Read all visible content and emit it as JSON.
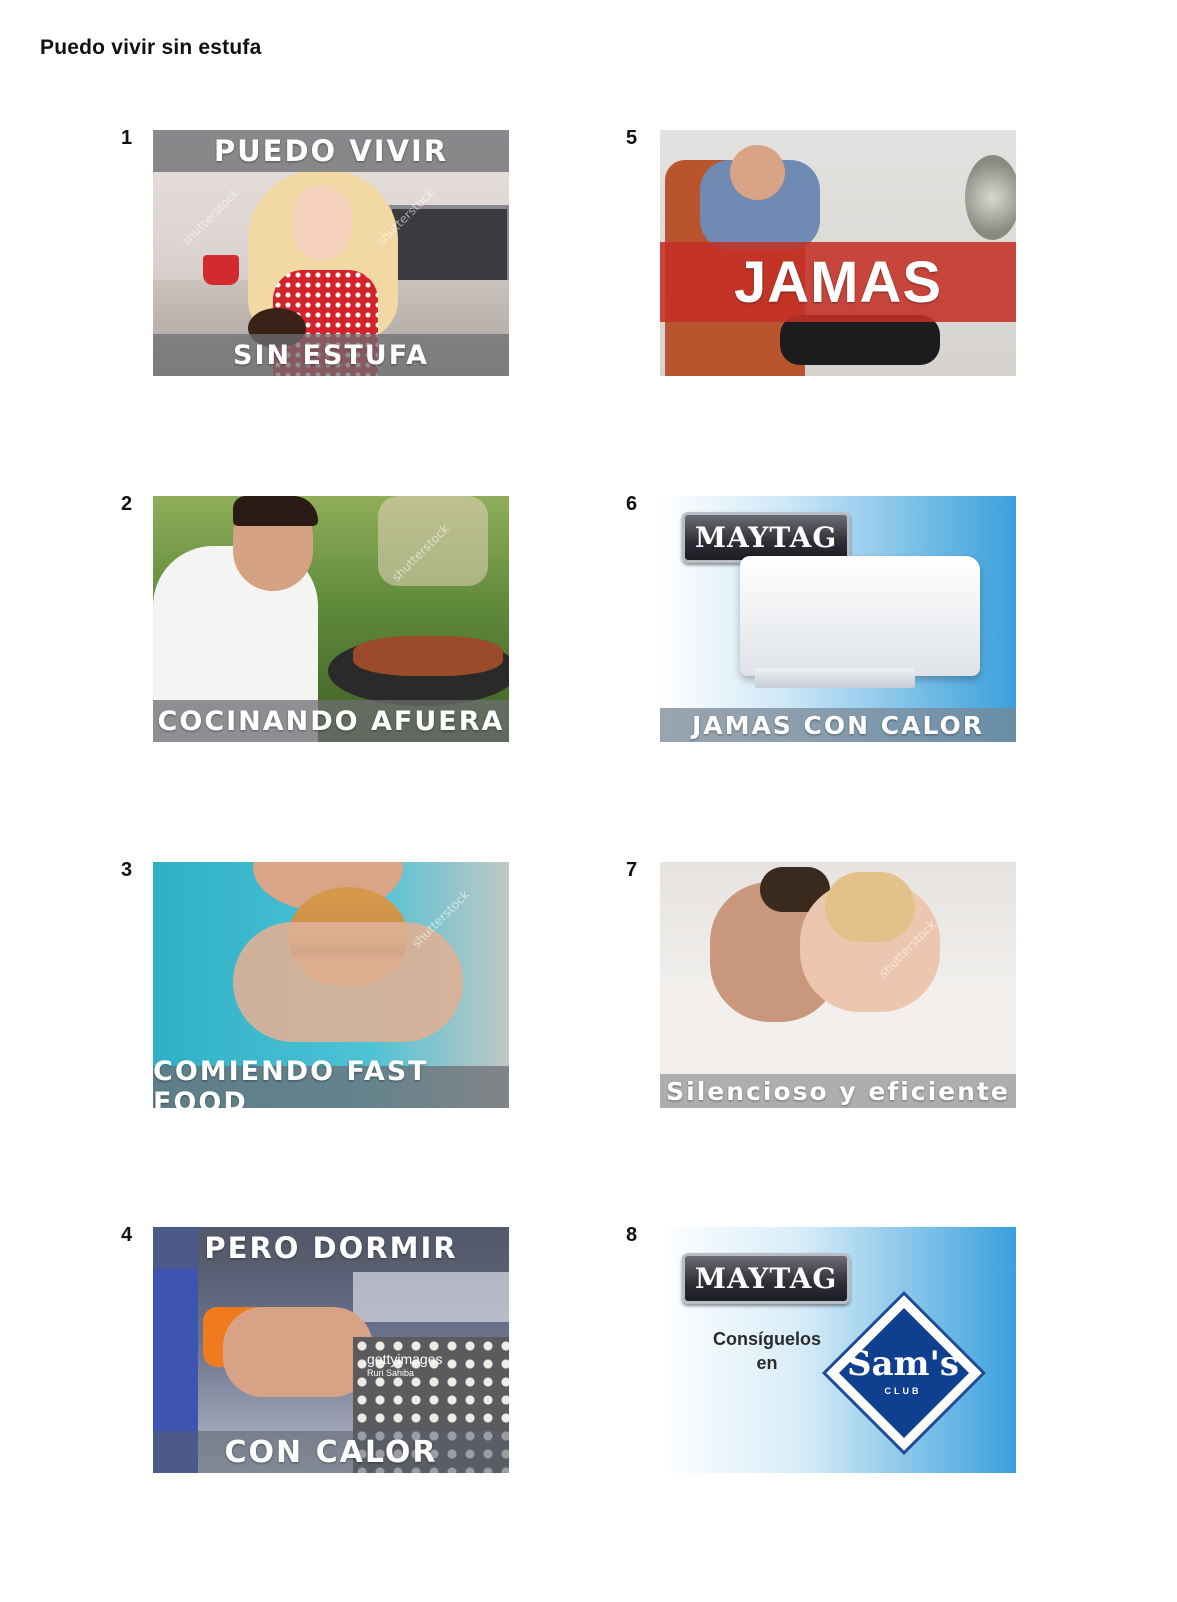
{
  "page": {
    "title": "Puedo vivir sin estufa"
  },
  "panels": [
    {
      "number": "1",
      "top_text": "PUEDO VIVIR",
      "bottom_text": "SIN ESTUFA"
    },
    {
      "number": "2",
      "bottom_text": "COCINANDO AFUERA"
    },
    {
      "number": "3",
      "bottom_text": "COMIENDO FAST FOOD"
    },
    {
      "number": "4",
      "top_text": "PERO DORMIR",
      "bottom_text": "CON CALOR",
      "credit_brand": "gettyimages",
      "credit_name": "Ruri Sahiba"
    },
    {
      "number": "5",
      "center_text": "JAMAS"
    },
    {
      "number": "6",
      "brand": "MAYTAG",
      "bottom_text": "JAMAS CON CALOR"
    },
    {
      "number": "7",
      "bottom_text": "Silencioso y eficiente"
    },
    {
      "number": "8",
      "brand": "MAYTAG",
      "caption_line1": "Consíguelos",
      "caption_line2": "en",
      "store_name": "Sam's",
      "store_sub": "CLUB"
    }
  ],
  "watermark_text": "shutterstock",
  "colors": {
    "band_gray": "#6e6e73",
    "band_red": "#c43026",
    "sky_blue": "#3aa0dc",
    "sams_blue": "#0f3f8f"
  }
}
